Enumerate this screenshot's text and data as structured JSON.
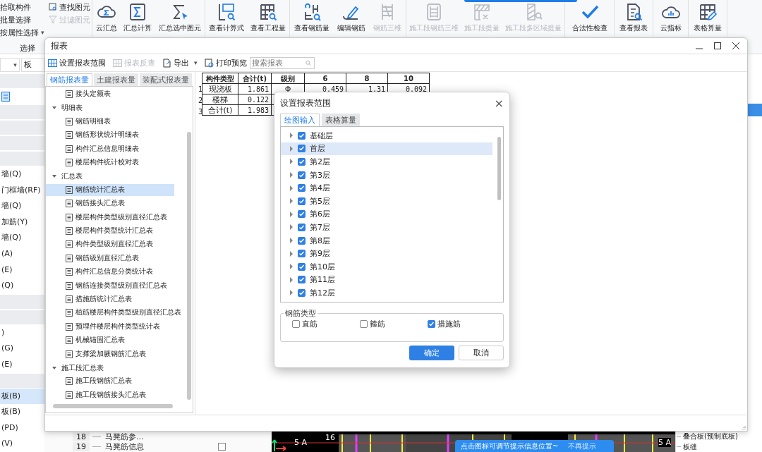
{
  "ribbon": {
    "top_banner": true,
    "select_group": {
      "label": "选择",
      "items": [
        {
          "label": "拾取构件"
        },
        {
          "label": "批量选择"
        },
        {
          "label": "按属性选择",
          "caret": "▾"
        }
      ],
      "find": [
        {
          "label": "查找图元",
          "disabled": false
        },
        {
          "label": "过滤图元",
          "disabled": true
        }
      ]
    },
    "groups": [
      {
        "buttons": [
          {
            "label": "云汇总",
            "disabled": false
          },
          {
            "label": "汇总计算",
            "disabled": false
          },
          {
            "label": "汇总选中图元",
            "disabled": false
          }
        ]
      },
      {
        "buttons": [
          {
            "label": "查看计算式",
            "disabled": false
          },
          {
            "label": "查看工程量",
            "disabled": false
          }
        ]
      },
      {
        "buttons": [
          {
            "label": "查看钢筋量",
            "disabled": false
          },
          {
            "label": "编辑钢筋",
            "disabled": false
          },
          {
            "label": "钢筋三维",
            "disabled": true
          }
        ]
      },
      {
        "buttons": [
          {
            "label": "施工段钢筋三维",
            "disabled": true
          },
          {
            "label": "施工段提量",
            "disabled": true
          },
          {
            "label": "施工段多区域提量",
            "disabled": true
          }
        ]
      },
      {
        "buttons": [
          {
            "label": "合法性检查",
            "disabled": false
          }
        ]
      },
      {
        "buttons": [
          {
            "label": "查看报表",
            "disabled": false
          }
        ]
      },
      {
        "buttons": [
          {
            "label": "云指标",
            "disabled": false
          }
        ]
      },
      {
        "buttons": [
          {
            "label": "表格算量",
            "disabled": false
          }
        ]
      }
    ]
  },
  "left_panel": {
    "filter": {
      "caret": "▾",
      "value": "板"
    },
    "rows": [
      {
        "kind": "band"
      },
      {
        "kind": "icon",
        "selected": true
      },
      {
        "kind": "band"
      },
      {
        "kind": "band"
      },
      {
        "kind": "band"
      },
      {
        "kind": "band"
      },
      {
        "kind": "item",
        "label": "墙(Q)",
        "selected": false
      },
      {
        "kind": "item",
        "label": "门框墙(RF)",
        "selected": false
      },
      {
        "kind": "item",
        "label": "墙(Q)",
        "selected": false
      },
      {
        "kind": "item",
        "label": "加筋(Y)",
        "selected": false
      },
      {
        "kind": "item",
        "label": "墙(Q)",
        "selected": false
      },
      {
        "kind": "item",
        "label": "(A)",
        "selected": false
      },
      {
        "kind": "item",
        "label": "(E)",
        "selected": false
      },
      {
        "kind": "item",
        "label": "(Q)",
        "selected": false
      },
      {
        "kind": "band"
      },
      {
        "kind": "band"
      },
      {
        "kind": "item",
        "label": ")",
        "selected": false
      },
      {
        "kind": "item",
        "label": "(G)",
        "selected": false
      },
      {
        "kind": "item",
        "label": "(E)",
        "selected": false
      },
      {
        "kind": "band"
      },
      {
        "kind": "item",
        "label": "板(B)",
        "selected": true
      },
      {
        "kind": "item",
        "label": "板(B)",
        "selected": false
      },
      {
        "kind": "item",
        "label": "(PD)",
        "selected": false
      },
      {
        "kind": "item",
        "label": "(V)",
        "selected": false
      }
    ]
  },
  "bottom_rows": [
    {
      "number": "18",
      "label": "马凳筋参..."
    },
    {
      "number": "19",
      "label": "马凳筋信息",
      "checked": false
    }
  ],
  "cad": {
    "labels": [
      "5 A",
      "16",
      "5 A"
    ]
  },
  "hint": {
    "text": "点击图标可调节提示信息位置~",
    "action": "不再提示"
  },
  "right_panel": {
    "rows": [
      "叠合板(预制底板)",
      "板缝"
    ]
  },
  "report": {
    "title": "报表",
    "toolbar": [
      {
        "label": "设置报表范围",
        "disabled": false
      },
      {
        "label": "报表反查",
        "disabled": true
      },
      {
        "label": "导出",
        "disabled": false,
        "caret": "▾"
      },
      {
        "label": "打印预览",
        "disabled": false
      }
    ],
    "search": {
      "placeholder": "搜索报表"
    },
    "tabs": [
      {
        "label": "钢筋报表量",
        "selected": true
      },
      {
        "label": "土建报表量",
        "selected": false
      },
      {
        "label": "装配式报表量",
        "selected": false
      }
    ],
    "tree": [
      {
        "children": [
          {
            "label": "接头定额表",
            "selected": false
          }
        ]
      },
      {
        "label": "明细表",
        "expanded": true,
        "children": [
          {
            "label": "钢筋明细表",
            "selected": false
          },
          {
            "label": "钢筋形状统计明细表",
            "selected": false
          },
          {
            "label": "构件汇总信息明细表",
            "selected": false
          },
          {
            "label": "楼层构件统计校对表",
            "selected": false
          }
        ]
      },
      {
        "label": "汇总表",
        "expanded": true,
        "children": [
          {
            "label": "钢筋统计汇总表",
            "selected": true
          },
          {
            "label": "钢筋接头汇总表",
            "selected": false
          },
          {
            "label": "楼层构件类型级别直径汇总表",
            "selected": false
          },
          {
            "label": "楼层构件类型统计汇总表",
            "selected": false
          },
          {
            "label": "构件类型级别直径汇总表",
            "selected": false
          },
          {
            "label": "钢筋级别直径汇总表",
            "selected": false
          },
          {
            "label": "构件汇总信息分类统计表",
            "selected": false
          },
          {
            "label": "钢筋连接类型级别直径汇总表",
            "selected": false
          },
          {
            "label": "措施筋统计汇总表",
            "selected": false
          },
          {
            "label": "植筋楼层构件类型级别直径汇总表",
            "selected": false
          },
          {
            "label": "预埋件楼层构件类型统计表",
            "selected": false
          },
          {
            "label": "机械锚固汇总表",
            "selected": false
          },
          {
            "label": "支撑梁加腋钢筋汇总表",
            "selected": false
          }
        ]
      },
      {
        "label": "施工段汇总表",
        "expanded": true,
        "children": [
          {
            "label": "施工段钢筋汇总表",
            "selected": false
          },
          {
            "label": "施工段钢筋接头汇总表",
            "selected": false
          }
        ]
      }
    ],
    "table": {
      "columns": [
        "构件类型",
        "合计(t)",
        "级别",
        "6",
        "8",
        "10"
      ],
      "rows": [
        {
          "number": "1",
          "cells": [
            "现浇板",
            "1.861",
            "Φ",
            "0.459",
            "1.31",
            "0.092"
          ]
        },
        {
          "number": "2",
          "cells": [
            "楼梯",
            "0.122"
          ]
        },
        {
          "number": "3",
          "cells": [
            "合计(t)",
            "1.983"
          ]
        }
      ]
    }
  },
  "dialog": {
    "title": "设置报表范围",
    "close": "×",
    "tabs": [
      {
        "label": "绘图输入",
        "selected": true
      },
      {
        "label": "表格算量",
        "selected": false
      }
    ],
    "floors": [
      {
        "label": "基础层",
        "checked": true,
        "selected": false,
        "expanded": false
      },
      {
        "label": "首层",
        "checked": true,
        "selected": true,
        "expanded": false
      },
      {
        "label": "第2层",
        "checked": true,
        "selected": false,
        "expanded": false
      },
      {
        "label": "第3层",
        "checked": true,
        "selected": false,
        "expanded": false
      },
      {
        "label": "第4层",
        "checked": true,
        "selected": false,
        "expanded": false
      },
      {
        "label": "第5层",
        "checked": true,
        "selected": false,
        "expanded": false
      },
      {
        "label": "第6层",
        "checked": true,
        "selected": false,
        "expanded": false
      },
      {
        "label": "第7层",
        "checked": true,
        "selected": false,
        "expanded": false
      },
      {
        "label": "第8层",
        "checked": true,
        "selected": false,
        "expanded": false
      },
      {
        "label": "第9层",
        "checked": true,
        "selected": false,
        "expanded": false
      },
      {
        "label": "第10层",
        "checked": true,
        "selected": false,
        "expanded": false
      },
      {
        "label": "第11层",
        "checked": true,
        "selected": false,
        "expanded": false
      },
      {
        "label": "第12层",
        "checked": true,
        "selected": false,
        "expanded": false
      }
    ],
    "rebar_types": {
      "label": "钢筋类型",
      "options": [
        {
          "label": "直筋",
          "checked": false
        },
        {
          "label": "箍筋",
          "checked": false
        },
        {
          "label": "措施筋",
          "checked": true
        }
      ]
    },
    "buttons": [
      {
        "label": "确定",
        "kind": "primary"
      },
      {
        "label": "取消",
        "kind": "secondary"
      }
    ]
  }
}
